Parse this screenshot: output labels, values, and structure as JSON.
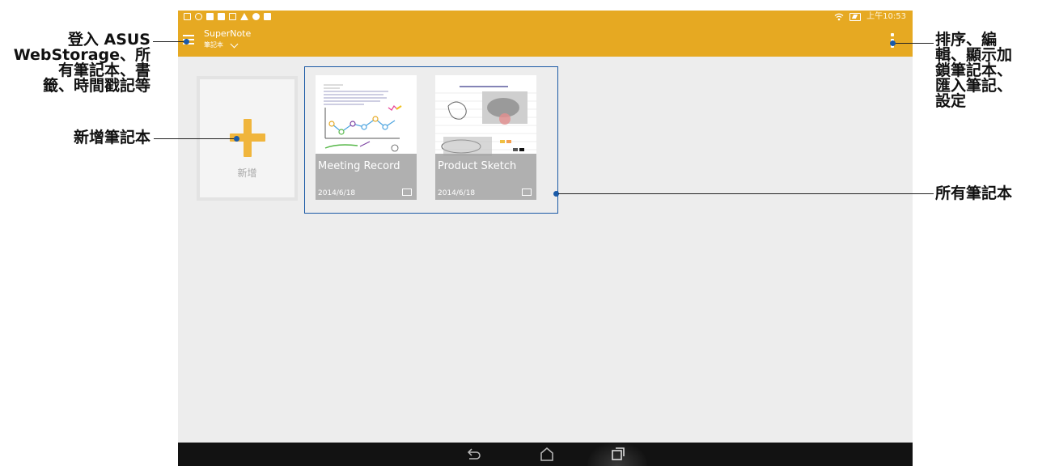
{
  "status_bar": {
    "time": "上午10:53",
    "icons_left": [
      "calendar-icon",
      "gps-icon",
      "sd-card-icon",
      "sim-icon",
      "image-icon",
      "warning-icon",
      "cloud-upload-icon",
      "play-icon"
    ],
    "icons_right": [
      "wifi-icon",
      "battery-charging-icon"
    ]
  },
  "app_bar": {
    "title": "SuperNote",
    "subtitle": "筆記本",
    "accent_color": "#e6a922"
  },
  "new_tile": {
    "label": "新增"
  },
  "notebooks": [
    {
      "title": "Meeting Record",
      "date": "2014/6/18"
    },
    {
      "title": "Product Sketch",
      "date": "2014/6/18"
    }
  ],
  "callouts": {
    "menu": [
      "登入 ASUS",
      "WebStorage、所",
      "有筆記本、書",
      "籤、時間戳記等"
    ],
    "new": "新增筆記本",
    "overflow": [
      "排序、編",
      "輯、顯示加",
      "鎖筆記本、",
      "匯入筆記、",
      "設定"
    ],
    "all": "所有筆記本"
  },
  "nav_bar": {
    "items": [
      "back-icon",
      "home-icon",
      "recent-apps-icon"
    ]
  }
}
